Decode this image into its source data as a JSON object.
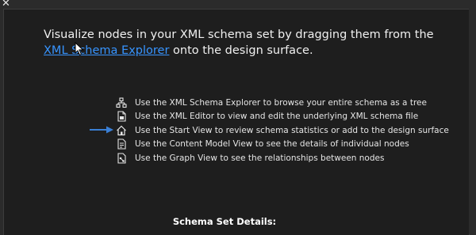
{
  "window": {
    "close_glyph": "✕"
  },
  "start_view": {
    "intro_text": "Visualize nodes in your XML schema set by dragging them from the ",
    "intro_link": "XML Schema Explorer",
    "intro_suffix": " onto the design surface."
  },
  "tips": [
    {
      "icon": "schema-explorer-icon",
      "label": "Use the XML Schema Explorer to browse your entire schema as a tree"
    },
    {
      "icon": "xml-editor-icon",
      "label": "Use the XML Editor to view and edit the underlying XML schema file"
    },
    {
      "icon": "start-view-home-icon",
      "label": "Use the Start View to review schema statistics or add to the design surface"
    },
    {
      "icon": "content-model-icon",
      "label": "Use the Content Model View to see the details of individual nodes"
    },
    {
      "icon": "graph-view-icon",
      "label": "Use the Graph View to see the relationships between nodes"
    }
  ],
  "details": {
    "heading": "Schema Set Details:"
  },
  "colors": {
    "background": "#1e1e1e",
    "link": "#3794ff",
    "arrow": "#3a7fd5"
  }
}
